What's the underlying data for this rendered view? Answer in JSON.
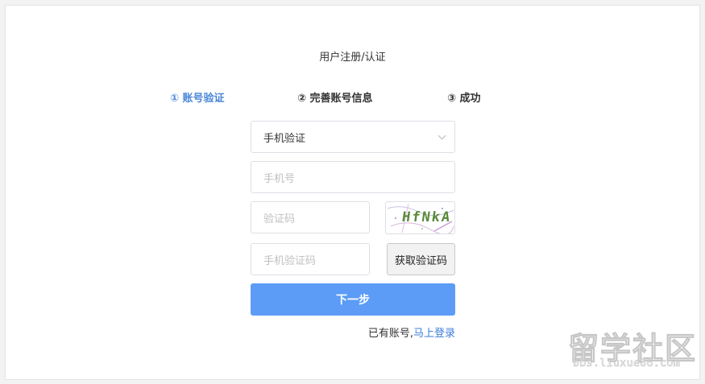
{
  "page": {
    "title": "用户注册/认证"
  },
  "steps": [
    {
      "label": "① 账号验证",
      "active": true
    },
    {
      "label": "② 完善账号信息",
      "active": false
    },
    {
      "label": "③ 成功",
      "active": false
    }
  ],
  "form": {
    "verify_method": {
      "value": "手机验证",
      "icon": "chevron-down-icon"
    },
    "phone": {
      "placeholder": "手机号",
      "value": ""
    },
    "captcha_input": {
      "placeholder": "验证码",
      "value": ""
    },
    "captcha_image_text": "HfNkA",
    "sms_code": {
      "placeholder": "手机验证码",
      "value": ""
    },
    "get_code_label": "获取验证码",
    "next_label": "下一步"
  },
  "login_prompt": {
    "text": "已有账号,",
    "link": "马上登录"
  },
  "watermark": {
    "big": "留学社区",
    "small": "bbs.liuxue86.com"
  },
  "colors": {
    "accent": "#4a86d8",
    "button": "#5c9cf7",
    "link": "#3d7ed8"
  }
}
